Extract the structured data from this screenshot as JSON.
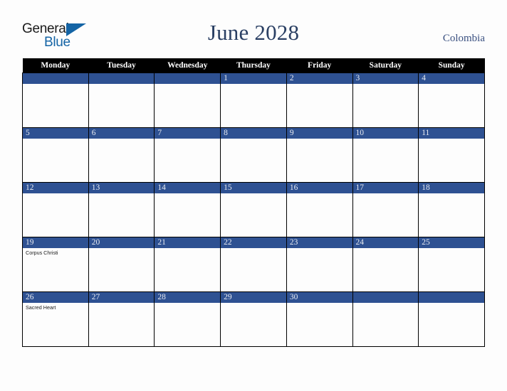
{
  "brand": {
    "name_part1": "General",
    "name_part2": "Blue",
    "accent_color": "#1464a5"
  },
  "header": {
    "title": "June 2028",
    "country": "Colombia",
    "title_color": "#2a3f63",
    "country_color": "#3a5080"
  },
  "calendar": {
    "month": "June",
    "year": "2028",
    "weekday_headers": [
      "Monday",
      "Tuesday",
      "Wednesday",
      "Thursday",
      "Friday",
      "Saturday",
      "Sunday"
    ],
    "header_background": "#000000",
    "date_band_color": "#2e5192",
    "weeks": [
      [
        {
          "date": "",
          "events": []
        },
        {
          "date": "",
          "events": []
        },
        {
          "date": "",
          "events": []
        },
        {
          "date": "1",
          "events": []
        },
        {
          "date": "2",
          "events": []
        },
        {
          "date": "3",
          "events": []
        },
        {
          "date": "4",
          "events": []
        }
      ],
      [
        {
          "date": "5",
          "events": []
        },
        {
          "date": "6",
          "events": []
        },
        {
          "date": "7",
          "events": []
        },
        {
          "date": "8",
          "events": []
        },
        {
          "date": "9",
          "events": []
        },
        {
          "date": "10",
          "events": []
        },
        {
          "date": "11",
          "events": []
        }
      ],
      [
        {
          "date": "12",
          "events": []
        },
        {
          "date": "13",
          "events": []
        },
        {
          "date": "14",
          "events": []
        },
        {
          "date": "15",
          "events": []
        },
        {
          "date": "16",
          "events": []
        },
        {
          "date": "17",
          "events": []
        },
        {
          "date": "18",
          "events": []
        }
      ],
      [
        {
          "date": "19",
          "events": [
            "Corpus Christi"
          ]
        },
        {
          "date": "20",
          "events": []
        },
        {
          "date": "21",
          "events": []
        },
        {
          "date": "22",
          "events": []
        },
        {
          "date": "23",
          "events": []
        },
        {
          "date": "24",
          "events": []
        },
        {
          "date": "25",
          "events": []
        }
      ],
      [
        {
          "date": "26",
          "events": [
            "Sacred Heart"
          ]
        },
        {
          "date": "27",
          "events": []
        },
        {
          "date": "28",
          "events": []
        },
        {
          "date": "29",
          "events": []
        },
        {
          "date": "30",
          "events": []
        },
        {
          "date": "",
          "events": []
        },
        {
          "date": "",
          "events": []
        }
      ]
    ]
  }
}
